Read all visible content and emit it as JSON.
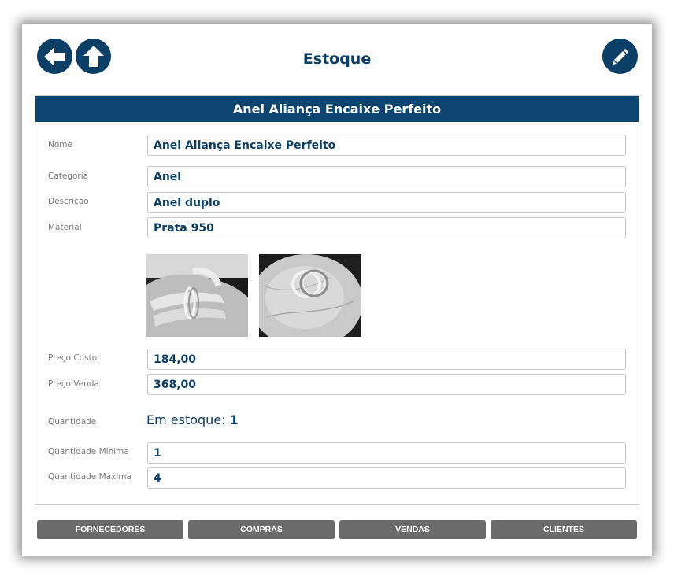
{
  "header": {
    "title": "Estoque",
    "back_icon": "arrow-left-icon",
    "home_icon": "arrow-up-icon",
    "edit_icon": "pencil-icon"
  },
  "product": {
    "heading": "Anel Aliança Encaixe Perfeito",
    "fields": {
      "nome": {
        "label": "Nome",
        "value": "Anel Aliança Encaixe Perfeito"
      },
      "categoria": {
        "label": "Categoria",
        "value": "Anel"
      },
      "descricao": {
        "label": "Descrição",
        "value": "Anel duplo"
      },
      "material": {
        "label": "Material",
        "value": "Prata 950"
      },
      "preco_custo": {
        "label": "Preço Custo",
        "value": "184,00"
      },
      "preco_venda": {
        "label": "Preço Venda",
        "value": "368,00"
      },
      "quantidade_minima": {
        "label": "Quantidade Mínima",
        "value": "1"
      },
      "quantidade_maxima": {
        "label": "Quantidade Máxima",
        "value": "4"
      }
    },
    "quantidade": {
      "label": "Quantidade",
      "prefix": "Em estoque:",
      "value": "1"
    }
  },
  "nav": {
    "fornecedores": "FORNECEDORES",
    "compras": "COMPRAS",
    "vendas": "VENDAS",
    "clientes": "CLIENTES"
  },
  "colors": {
    "primary": "#0c3f66",
    "header_bar": "#0c4670",
    "nav_button": "#6b6b6b"
  }
}
